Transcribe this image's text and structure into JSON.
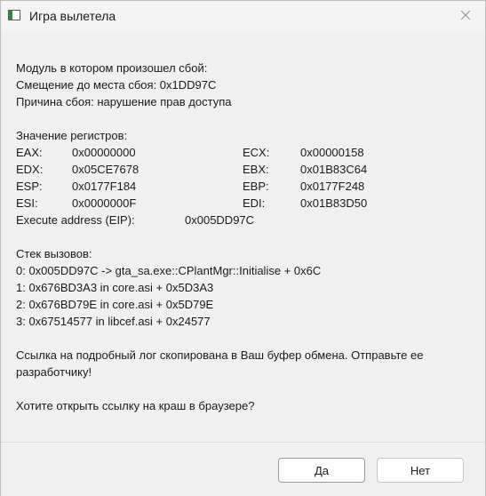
{
  "window": {
    "title": "Игра вылетела",
    "icon": "app-window-icon",
    "close_icon": "close-icon"
  },
  "crash": {
    "module_line": "Модуль в котором произошел сбой:",
    "offset_line": "Смещение до места сбоя: 0x1DD97C",
    "reason_line": "Причина сбоя: нарушение прав доступа"
  },
  "registers": {
    "heading": "Значение регистров:",
    "rows": [
      {
        "name1": "EAX:",
        "val1": "0x00000000",
        "name2": "ECX:",
        "val2": "0x00000158"
      },
      {
        "name1": "EDX:",
        "val1": "0x05CE7678",
        "name2": "EBX:",
        "val2": "0x01B83C64"
      },
      {
        "name1": "ESP:",
        "val1": "0x0177F184",
        "name2": "EBP:",
        "val2": "0x0177F248"
      },
      {
        "name1": "ESI:",
        "val1": "0x0000000F",
        "name2": "EDI:",
        "val2": "0x01B83D50"
      }
    ],
    "eip_label": "Execute address (EIP):",
    "eip_value": "0x005DD97C"
  },
  "stack": {
    "heading": "Стек вызовов:",
    "frames": [
      "0: 0x005DD97C -> gta_sa.exe::CPlantMgr::Initialise + 0x6C",
      "1: 0x676BD3A3 in core.asi + 0x5D3A3",
      "2: 0x676BD79E in core.asi + 0x5D79E",
      "3: 0x67514577 in libcef.asi + 0x24577"
    ]
  },
  "message": {
    "log_copied": "Ссылка на подробный лог скопирована в Ваш буфер обмена. Отправьте ее разработчику!",
    "question": "Хотите открыть ссылку на краш в браузере?"
  },
  "buttons": {
    "yes": "Да",
    "no": "Нет"
  },
  "colors": {
    "window_bg": "#f0f0f0",
    "text": "#1a1a1a",
    "button_bg": "#fdfdfd"
  }
}
